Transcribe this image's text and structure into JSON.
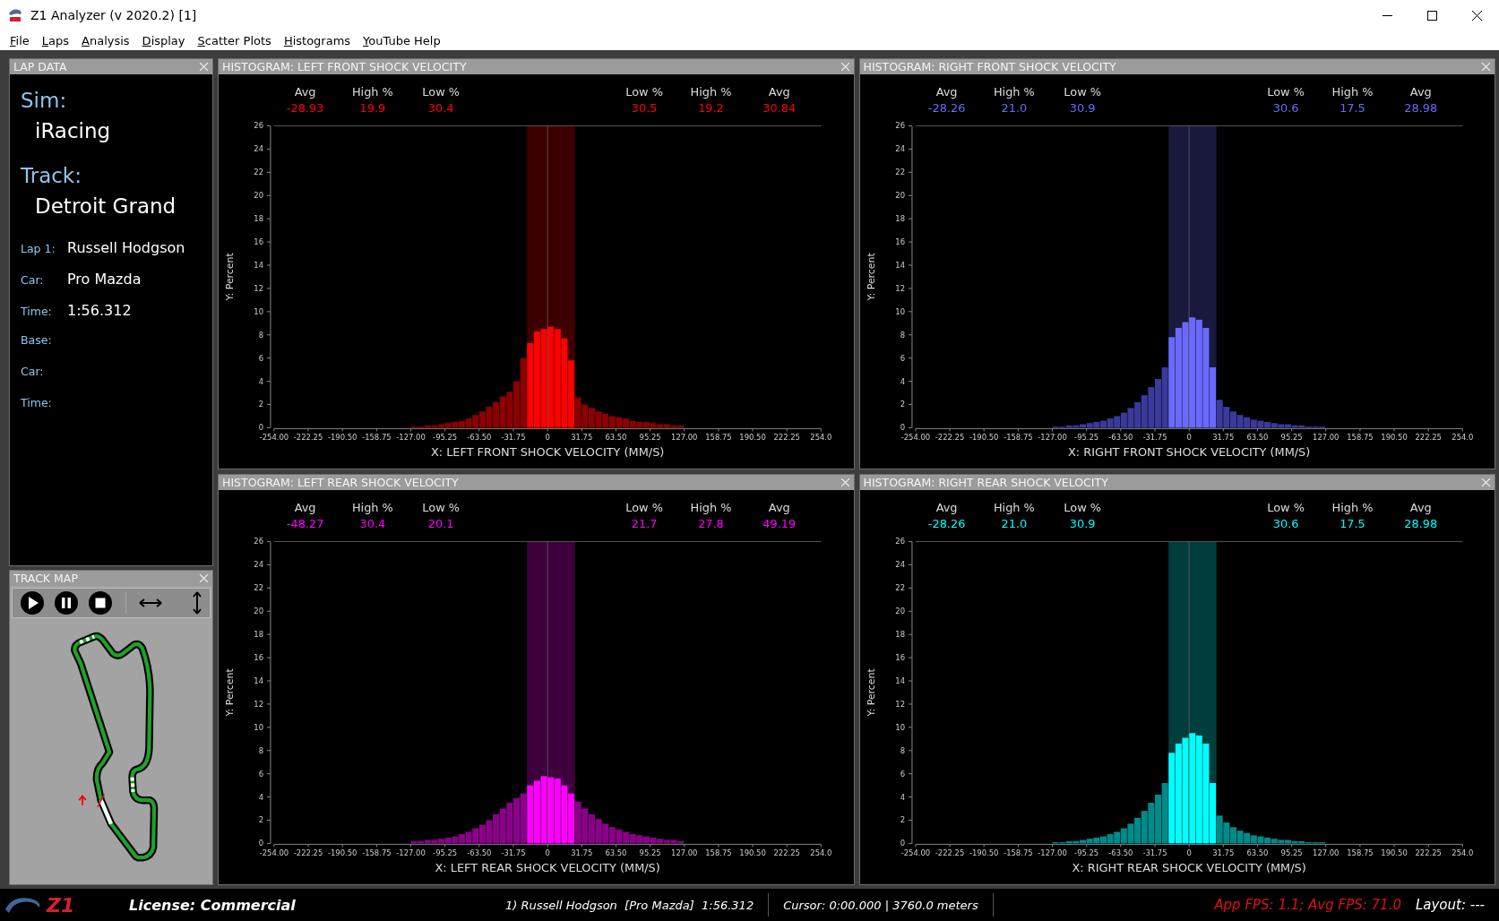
{
  "window": {
    "title": "Z1 Analyzer (v 2020.2) [1]"
  },
  "menu": [
    "File",
    "Laps",
    "Analysis",
    "Display",
    "Scatter Plots",
    "Histograms",
    "YouTube Help"
  ],
  "lap_data": {
    "title": "LAP DATA",
    "sim_label": "Sim:",
    "sim": "iRacing",
    "track_label": "Track:",
    "track": "Detroit Grand",
    "rows": [
      {
        "label": "Lap 1:",
        "value": "Russell Hodgson"
      },
      {
        "label": "Car:",
        "value": "Pro Mazda"
      },
      {
        "label": "Time:",
        "value": "1:56.312"
      },
      {
        "label": "Base:"
      },
      {
        "label": "Car:"
      },
      {
        "label": "Time:"
      }
    ]
  },
  "track_map": {
    "title": "TRACK MAP"
  },
  "histograms": [
    {
      "title": "HISTOGRAM: LEFT FRONT SHOCK VELOCITY",
      "stats_left": [
        {
          "label": "Avg",
          "value": "-28.93"
        },
        {
          "label": "High %",
          "value": "19.9"
        },
        {
          "label": "Low %",
          "value": "30.4"
        }
      ],
      "stats_right": [
        {
          "label": "Low %",
          "value": "30.5"
        },
        {
          "label": "High %",
          "value": "19.2"
        },
        {
          "label": "Avg",
          "value": "30.84"
        }
      ],
      "chart_data": {
        "type": "bar",
        "xlabel": "X: LEFT FRONT SHOCK VELOCITY (MM/S)",
        "ylabel": "Y: Percent",
        "xlim": [
          -254,
          254
        ],
        "ylim": [
          0,
          26
        ],
        "x": [
          -123.825,
          -117.475,
          -111.125,
          -104.775,
          -98.425,
          -92.075,
          -85.725,
          -79.375,
          -73.025,
          -66.675,
          -60.325,
          -53.975,
          -47.625,
          -41.275,
          -34.925,
          -28.575,
          -22.225,
          -15.875,
          -9.525,
          -3.175,
          3.175,
          9.525,
          15.875,
          22.225,
          28.575,
          34.925,
          41.275,
          47.625,
          53.975,
          60.325,
          66.675,
          73.025,
          79.375,
          85.725,
          92.075,
          98.425,
          104.775,
          111.125,
          117.475,
          123.825
        ],
        "series": [
          {
            "color": "#8b0000",
            "values": [
              0.1,
              0.1,
              0.2,
              0.2,
              0.3,
              0.4,
              0.5,
              0.6,
              0.8,
              1.1,
              1.4,
              1.8,
              2.2,
              2.7,
              3.1,
              4.0,
              6.0,
              null,
              null,
              null,
              null,
              null,
              null,
              null,
              2.6,
              2.0,
              1.7,
              1.4,
              1.2,
              1.0,
              0.9,
              0.8,
              0.6,
              0.5,
              0.5,
              0.4,
              0.3,
              0.3,
              0.2,
              0.2
            ]
          },
          {
            "color": "#ff0000",
            "values": [
              null,
              null,
              null,
              null,
              null,
              null,
              null,
              null,
              null,
              null,
              null,
              null,
              null,
              null,
              null,
              null,
              null,
              7.3,
              8.3,
              8.5,
              8.7,
              8.5,
              7.7,
              5.8,
              null,
              null,
              null,
              null,
              null,
              null,
              null,
              null,
              null,
              null,
              null,
              null,
              null,
              null,
              null,
              null
            ]
          }
        ],
        "xticks": [
          {
            "value": -254,
            "label": "-254.00"
          },
          {
            "value": -222.25,
            "label": "-222.25"
          },
          {
            "value": -190.5,
            "label": "-190.50"
          },
          {
            "value": -158.75,
            "label": "-158.75"
          },
          {
            "value": -127,
            "label": "-127.00"
          },
          {
            "value": -95.25,
            "label": "-95.25"
          },
          {
            "value": -63.5,
            "label": "-63.50"
          },
          {
            "value": -31.75,
            "label": "-31.75"
          },
          {
            "value": 0,
            "label": "0"
          },
          {
            "value": 31.75,
            "label": "31.75"
          },
          {
            "value": 63.5,
            "label": "63.50"
          },
          {
            "value": 95.25,
            "label": "95.25"
          },
          {
            "value": 127,
            "label": "127.00"
          },
          {
            "value": 158.75,
            "label": "158.75"
          },
          {
            "value": 190.5,
            "label": "190.50"
          },
          {
            "value": 222.25,
            "label": "222.25"
          },
          {
            "value": 254,
            "label": "254.0"
          }
        ],
        "yticks": [
          0,
          2,
          4,
          6,
          8,
          10,
          12,
          14,
          16,
          18,
          20,
          22,
          24,
          26
        ]
      }
    },
    {
      "title": "HISTOGRAM: RIGHT FRONT SHOCK VELOCITY",
      "stats_left": [
        {
          "label": "Avg",
          "value": "-28.26"
        },
        {
          "label": "High %",
          "value": "21.0"
        },
        {
          "label": "Low %",
          "value": "30.9"
        }
      ],
      "stats_right": [
        {
          "label": "Low %",
          "value": "30.6"
        },
        {
          "label": "High %",
          "value": "17.5"
        },
        {
          "label": "Avg",
          "value": "28.98"
        }
      ],
      "chart_data": {
        "type": "bar",
        "xlabel": "X: RIGHT FRONT SHOCK VELOCITY (MM/S)",
        "ylabel": "Y: Percent",
        "xlim": [
          -254,
          254
        ],
        "ylim": [
          0,
          26
        ],
        "x": [
          -123.825,
          -117.475,
          -111.125,
          -104.775,
          -98.425,
          -92.075,
          -85.725,
          -79.375,
          -73.025,
          -66.675,
          -60.325,
          -53.975,
          -47.625,
          -41.275,
          -34.925,
          -28.575,
          -22.225,
          -15.875,
          -9.525,
          -3.175,
          3.175,
          9.525,
          15.875,
          22.225,
          28.575,
          34.925,
          41.275,
          47.625,
          53.975,
          60.325,
          66.675,
          73.025,
          79.375,
          85.725,
          92.075,
          98.425,
          104.775,
          111.125,
          117.475,
          123.825
        ],
        "series": [
          {
            "color": "#3a3a9c",
            "values": [
              0.1,
              0.1,
              0.2,
              0.2,
              0.3,
              0.4,
              0.5,
              0.6,
              0.8,
              1.0,
              1.3,
              1.7,
              2.2,
              2.8,
              3.5,
              4.2,
              5.2,
              null,
              null,
              null,
              null,
              null,
              null,
              null,
              2.4,
              1.8,
              1.4,
              1.1,
              0.9,
              0.7,
              0.6,
              0.5,
              0.4,
              0.3,
              0.3,
              0.2,
              0.2,
              0.1,
              0.1,
              0.1
            ]
          },
          {
            "color": "#6a6aff",
            "values": [
              null,
              null,
              null,
              null,
              null,
              null,
              null,
              null,
              null,
              null,
              null,
              null,
              null,
              null,
              null,
              null,
              null,
              7.8,
              8.6,
              9.1,
              9.5,
              9.3,
              8.6,
              5.2,
              null,
              null,
              null,
              null,
              null,
              null,
              null,
              null,
              null,
              null,
              null,
              null,
              null,
              null,
              null,
              null
            ]
          }
        ],
        "xticks": [
          {
            "value": -254,
            "label": "-254.00"
          },
          {
            "value": -222.25,
            "label": "-222.25"
          },
          {
            "value": -190.5,
            "label": "-190.50"
          },
          {
            "value": -158.75,
            "label": "-158.75"
          },
          {
            "value": -127,
            "label": "-127.00"
          },
          {
            "value": -95.25,
            "label": "-95.25"
          },
          {
            "value": -63.5,
            "label": "-63.50"
          },
          {
            "value": -31.75,
            "label": "-31.75"
          },
          {
            "value": 0,
            "label": "0"
          },
          {
            "value": 31.75,
            "label": "31.75"
          },
          {
            "value": 63.5,
            "label": "63.50"
          },
          {
            "value": 95.25,
            "label": "95.25"
          },
          {
            "value": 127,
            "label": "127.00"
          },
          {
            "value": 158.75,
            "label": "158.75"
          },
          {
            "value": 190.5,
            "label": "190.50"
          },
          {
            "value": 222.25,
            "label": "222.25"
          },
          {
            "value": 254,
            "label": "254.0"
          }
        ],
        "yticks": [
          0,
          2,
          4,
          6,
          8,
          10,
          12,
          14,
          16,
          18,
          20,
          22,
          24,
          26
        ]
      }
    },
    {
      "title": "HISTOGRAM: LEFT REAR SHOCK VELOCITY",
      "stats_left": [
        {
          "label": "Avg",
          "value": "-48.27"
        },
        {
          "label": "High %",
          "value": "30.4"
        },
        {
          "label": "Low %",
          "value": "20.1"
        }
      ],
      "stats_right": [
        {
          "label": "Low %",
          "value": "21.7"
        },
        {
          "label": "High %",
          "value": "27.8"
        },
        {
          "label": "Avg",
          "value": "49.19"
        }
      ],
      "chart_data": {
        "type": "bar",
        "xlabel": "X: LEFT REAR SHOCK VELOCITY (MM/S)",
        "ylabel": "Y: Percent",
        "xlim": [
          -254,
          254
        ],
        "ylim": [
          0,
          26
        ],
        "x": [
          -123.825,
          -117.475,
          -111.125,
          -104.775,
          -98.425,
          -92.075,
          -85.725,
          -79.375,
          -73.025,
          -66.675,
          -60.325,
          -53.975,
          -47.625,
          -41.275,
          -34.925,
          -28.575,
          -22.225,
          -15.875,
          -9.525,
          -3.175,
          3.175,
          9.525,
          15.875,
          22.225,
          28.575,
          34.925,
          41.275,
          47.625,
          53.975,
          60.325,
          66.675,
          73.025,
          79.375,
          85.725,
          92.075,
          98.425,
          104.775,
          111.125,
          117.475,
          123.825
        ],
        "series": [
          {
            "color": "#8b008b",
            "values": [
              0.2,
              0.2,
              0.3,
              0.3,
              0.4,
              0.5,
              0.6,
              0.8,
              1.0,
              1.3,
              1.6,
              2.0,
              2.5,
              3.0,
              3.5,
              3.9,
              4.3,
              null,
              null,
              null,
              null,
              null,
              null,
              null,
              3.6,
              3.0,
              2.5,
              2.1,
              1.7,
              1.4,
              1.2,
              1.0,
              0.8,
              0.7,
              0.6,
              0.5,
              0.4,
              0.3,
              0.3,
              0.2
            ]
          },
          {
            "color": "#ff00ff",
            "values": [
              null,
              null,
              null,
              null,
              null,
              null,
              null,
              null,
              null,
              null,
              null,
              null,
              null,
              null,
              null,
              null,
              null,
              5.0,
              5.4,
              5.8,
              5.7,
              5.6,
              5.0,
              4.3,
              null,
              null,
              null,
              null,
              null,
              null,
              null,
              null,
              null,
              null,
              null,
              null,
              null,
              null,
              null,
              null
            ]
          }
        ],
        "xticks": [
          {
            "value": -254,
            "label": "-254.00"
          },
          {
            "value": -222.25,
            "label": "-222.25"
          },
          {
            "value": -190.5,
            "label": "-190.50"
          },
          {
            "value": -158.75,
            "label": "-158.75"
          },
          {
            "value": -127,
            "label": "-127.00"
          },
          {
            "value": -95.25,
            "label": "-95.25"
          },
          {
            "value": -63.5,
            "label": "-63.50"
          },
          {
            "value": -31.75,
            "label": "-31.75"
          },
          {
            "value": 0,
            "label": "0"
          },
          {
            "value": 31.75,
            "label": "31.75"
          },
          {
            "value": 63.5,
            "label": "63.50"
          },
          {
            "value": 95.25,
            "label": "95.25"
          },
          {
            "value": 127,
            "label": "127.00"
          },
          {
            "value": 158.75,
            "label": "158.75"
          },
          {
            "value": 190.5,
            "label": "190.50"
          },
          {
            "value": 222.25,
            "label": "222.25"
          },
          {
            "value": 254,
            "label": "254.0"
          }
        ],
        "yticks": [
          0,
          2,
          4,
          6,
          8,
          10,
          12,
          14,
          16,
          18,
          20,
          22,
          24,
          26
        ]
      }
    },
    {
      "title": "HISTOGRAM: RIGHT REAR SHOCK VELOCITY",
      "stats_left": [
        {
          "label": "Avg",
          "value": "-28.26"
        },
        {
          "label": "High %",
          "value": "21.0"
        },
        {
          "label": "Low %",
          "value": "30.9"
        }
      ],
      "stats_right": [
        {
          "label": "Low %",
          "value": "30.6"
        },
        {
          "label": "High %",
          "value": "17.5"
        },
        {
          "label": "Avg",
          "value": "28.98"
        }
      ],
      "chart_data": {
        "type": "bar",
        "xlabel": "X: RIGHT REAR SHOCK VELOCITY (MM/S)",
        "ylabel": "Y: Percent",
        "xlim": [
          -254,
          254
        ],
        "ylim": [
          0,
          26
        ],
        "x": [
          -123.825,
          -117.475,
          -111.125,
          -104.775,
          -98.425,
          -92.075,
          -85.725,
          -79.375,
          -73.025,
          -66.675,
          -60.325,
          -53.975,
          -47.625,
          -41.275,
          -34.925,
          -28.575,
          -22.225,
          -15.875,
          -9.525,
          -3.175,
          3.175,
          9.525,
          15.875,
          22.225,
          28.575,
          34.925,
          41.275,
          47.625,
          53.975,
          60.325,
          66.675,
          73.025,
          79.375,
          85.725,
          92.075,
          98.425,
          104.775,
          111.125,
          117.475,
          123.825
        ],
        "series": [
          {
            "color": "#008b8b",
            "values": [
              0.1,
              0.1,
              0.2,
              0.2,
              0.3,
              0.4,
              0.5,
              0.6,
              0.8,
              1.0,
              1.3,
              1.7,
              2.2,
              2.8,
              3.5,
              4.2,
              5.2,
              null,
              null,
              null,
              null,
              null,
              null,
              null,
              2.4,
              1.8,
              1.4,
              1.1,
              0.9,
              0.7,
              0.6,
              0.5,
              0.4,
              0.3,
              0.3,
              0.2,
              0.2,
              0.1,
              0.1,
              0.1
            ]
          },
          {
            "color": "#00ffff",
            "values": [
              null,
              null,
              null,
              null,
              null,
              null,
              null,
              null,
              null,
              null,
              null,
              null,
              null,
              null,
              null,
              null,
              null,
              7.8,
              8.6,
              9.1,
              9.5,
              9.3,
              8.6,
              5.2,
              null,
              null,
              null,
              null,
              null,
              null,
              null,
              null,
              null,
              null,
              null,
              null,
              null,
              null,
              null,
              null
            ]
          }
        ],
        "xticks": [
          {
            "value": -254,
            "label": "-254.00"
          },
          {
            "value": -222.25,
            "label": "-222.25"
          },
          {
            "value": -190.5,
            "label": "-190.50"
          },
          {
            "value": -158.75,
            "label": "-158.75"
          },
          {
            "value": -127,
            "label": "-127.00"
          },
          {
            "value": -95.25,
            "label": "-95.25"
          },
          {
            "value": -63.5,
            "label": "-63.50"
          },
          {
            "value": -31.75,
            "label": "-31.75"
          },
          {
            "value": 0,
            "label": "0"
          },
          {
            "value": 31.75,
            "label": "31.75"
          },
          {
            "value": 63.5,
            "label": "63.50"
          },
          {
            "value": 95.25,
            "label": "95.25"
          },
          {
            "value": 127,
            "label": "127.00"
          },
          {
            "value": 158.75,
            "label": "158.75"
          },
          {
            "value": 190.5,
            "label": "190.50"
          },
          {
            "value": 222.25,
            "label": "222.25"
          },
          {
            "value": 254,
            "label": "254.0"
          }
        ],
        "yticks": [
          0,
          2,
          4,
          6,
          8,
          10,
          12,
          14,
          16,
          18,
          20,
          22,
          24,
          26
        ]
      }
    }
  ],
  "status_bar": {
    "logo": "Z1",
    "license": "License: Commercial",
    "lap": "1) Russell Hodgson  [Pro Mazda]  1:56.312",
    "cursor": "Cursor: 0:00.000 | 3760.0 meters",
    "fps": "App FPS: 1.1; Avg FPS: 71.0",
    "layout": "Layout: ---"
  }
}
